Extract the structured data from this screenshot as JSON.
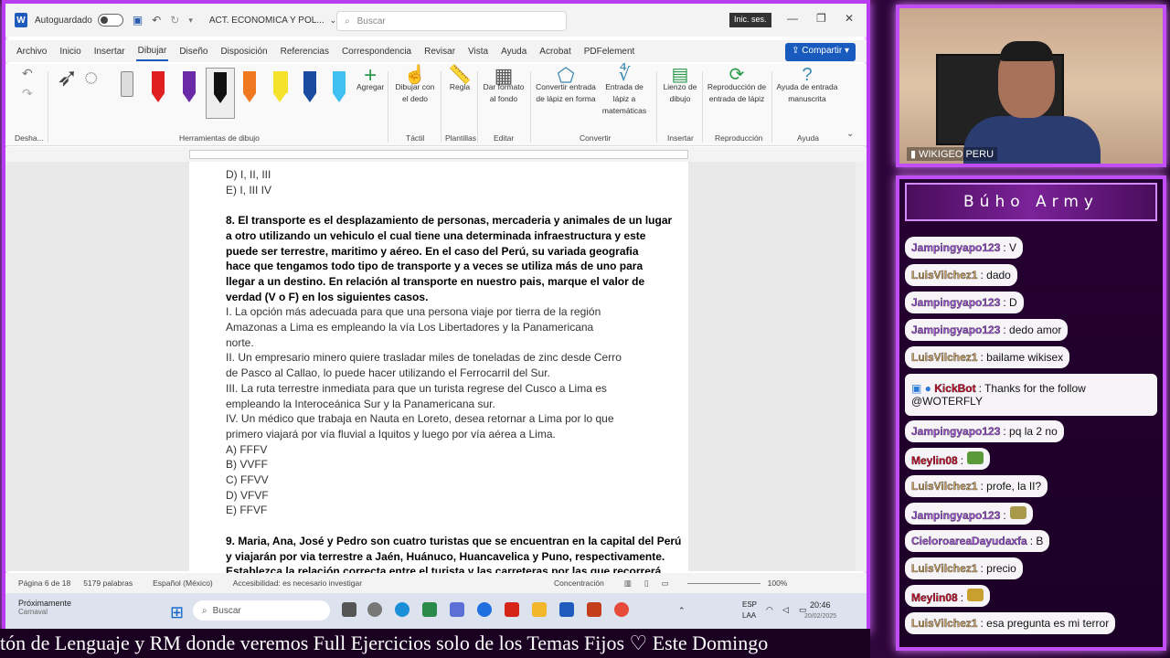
{
  "titlebar": {
    "autosave": "Autoguardado",
    "doc_title": "ACT. ECONOMICA Y POL...",
    "search_placeholder": "Buscar",
    "signin": "Inic. ses."
  },
  "menu": [
    "Archivo",
    "Inicio",
    "Insertar",
    "Dibujar",
    "Diseño",
    "Disposición",
    "Referencias",
    "Correspondencia",
    "Revisar",
    "Vista",
    "Ayuda",
    "Acrobat",
    "PDFelement"
  ],
  "share_label": "Compartir",
  "ribbon": {
    "undo_group": "Desha...",
    "drawing_group": "Herramientas de dibujo",
    "add_label": "Agregar",
    "draw_finger": "Dibujar con el dedo",
    "ruler": "Regla",
    "format_bg": "Dar formato al fondo",
    "convert_ink": "Convertir entrada de lápiz en forma",
    "math_ink": "Entrada de lápiz a matemáticas",
    "canvas": "Lienzo de dibujo",
    "replay": "Reproducción de entrada de lápiz",
    "help_ink": "Ayuda de entrada manuscrita",
    "groups": [
      "Táctil",
      "Plantillas",
      "Editar",
      "Convertir",
      "Insertar",
      "Reproducción",
      "Ayuda"
    ]
  },
  "document": {
    "lines": [
      {
        "t": "D) I, II, III",
        "b": false
      },
      {
        "t": "E) I, III IV",
        "b": false
      },
      {
        "t": "",
        "b": false
      },
      {
        "t": "8. El transporte es el desplazamiento de personas, mercaderia y animales de un lugar",
        "b": true
      },
      {
        "t": "a otro utilizando un vehiculo el cual tiene una determinada infraestructura y este",
        "b": true
      },
      {
        "t": "puede ser terrestre, maritimo y aéreo. En el caso del Perú, su variada geografia",
        "b": true
      },
      {
        "t": "hace que tengamos todo tipo de transporte y a veces se utiliza más de uno para",
        "b": true
      },
      {
        "t": "llegar a un destino. En relación al transporte en nuestro pais, marque el valor de",
        "b": true
      },
      {
        "t": "verdad (V o F) en los siguientes casos.",
        "b": true
      },
      {
        "t": "I. La opción más adecuada para que una persona viaje por tierra de la región",
        "b": false
      },
      {
        "t": "Amazonas a Lima es empleando la vía Los Libertadores y la Panamericana",
        "b": false
      },
      {
        "t": "norte.",
        "b": false
      },
      {
        "t": "II. Un empresario minero quiere trasladar miles de toneladas de zinc desde Cerro",
        "b": false
      },
      {
        "t": "de Pasco al Callao, lo puede hacer utilizando el Ferrocarril del Sur.",
        "b": false
      },
      {
        "t": "III. La ruta terrestre inmediata para que un turista regrese del Cusco a Lima es",
        "b": false
      },
      {
        "t": "empleando la Interoceánica Sur y la Panamericana sur.",
        "b": false
      },
      {
        "t": "IV. Un médico que trabaja en Nauta en Loreto, desea retornar a Lima por lo que",
        "b": false
      },
      {
        "t": "primero viajará por vía fluvial a Iquitos y luego por vía aérea a Lima.",
        "b": false
      },
      {
        "t": "A) FFFV",
        "b": false
      },
      {
        "t": "B) VVFF",
        "b": false
      },
      {
        "t": "C) FFVV",
        "b": false
      },
      {
        "t": "D) VFVF",
        "b": false
      },
      {
        "t": "E) FFVF",
        "b": false
      },
      {
        "t": "",
        "b": false
      },
      {
        "t": "9. Maria, Ana, José y Pedro son cuatro turistas que se encuentran en la capital del Perú",
        "b": true
      },
      {
        "t": "y viajarán por via terrestre a Jaén, Huánuco, Huancavelica y Puno, respectivamente.",
        "b": true
      },
      {
        "t": "Establezca la relación correcta entre el turista y las carreteras por las que recorrerá",
        "b": true
      }
    ]
  },
  "statusbar": {
    "page": "Página 6 de 18",
    "words": "5179 palabras",
    "lang": "Español (México)",
    "access": "Accesibilidad: es necesario investigar",
    "focus": "Concentración",
    "zoom": "100%"
  },
  "taskbar": {
    "notif_title": "Próximamente",
    "notif_sub": "Carnaval",
    "search": "Buscar",
    "lang": "ESP",
    "lang2": "LAA",
    "time": "20:46",
    "date": "20/02/2025"
  },
  "cam_name": "WIKIGEO PERU",
  "chat": {
    "title": "Búho Army",
    "messages": [
      {
        "user": "Jampingyapo123",
        "text": "V",
        "color": "#a055d8"
      },
      {
        "user": "LuisVilchez1",
        "text": "dado",
        "color": "#c9a060"
      },
      {
        "user": "Jampingyapo123",
        "text": "D",
        "color": "#a055d8"
      },
      {
        "user": "Jampingyapo123",
        "text": "dedo amor",
        "color": "#a055d8"
      },
      {
        "user": "LuisVilchez1",
        "text": "bailame wikisex",
        "color": "#c9a060"
      },
      {
        "user": "KickBot",
        "text": "Thanks for the follow @WOTERFLY",
        "color": "#c8102e"
      },
      {
        "user": "Jampingyapo123",
        "text": "pq la 2 no",
        "color": "#a055d8"
      },
      {
        "user": "Meylin08",
        "text": "",
        "color": "#c8102e"
      },
      {
        "user": "LuisVilchez1",
        "text": "profe, la II?",
        "color": "#c9a060"
      },
      {
        "user": "Jampingyapo123",
        "text": "",
        "color": "#a055d8"
      },
      {
        "user": "CieloroareaDayudaxfa",
        "text": "B",
        "color": "#a055d8"
      },
      {
        "user": "LuisVilchez1",
        "text": "precio",
        "color": "#c9a060"
      },
      {
        "user": "Meylin08",
        "text": "",
        "color": "#c8102e"
      },
      {
        "user": "LuisVilchez1",
        "text": "esa pregunta es mi terror",
        "color": "#c9a060"
      }
    ]
  },
  "ticker": "tón de Lenguaje y RM donde veremos Full Ejercicios solo de los Temas Fijos ♡      Este Domingo"
}
